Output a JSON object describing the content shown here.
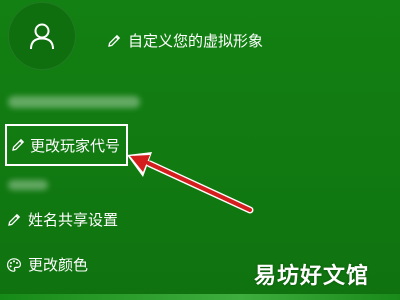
{
  "profile": {
    "customize_avatar_label": "自定义您的虚拟形象",
    "change_gamertag_label": "更改玩家代号",
    "name_sharing_label": "姓名共享设置",
    "change_color_label": "更改颜色"
  },
  "watermark": "易坊好文馆",
  "colors": {
    "background": "#127a12",
    "annotation_arrow": "#d41e1e"
  },
  "icons": {
    "avatar": "person-icon",
    "edit": "pencil-icon",
    "palette": "palette-icon"
  }
}
